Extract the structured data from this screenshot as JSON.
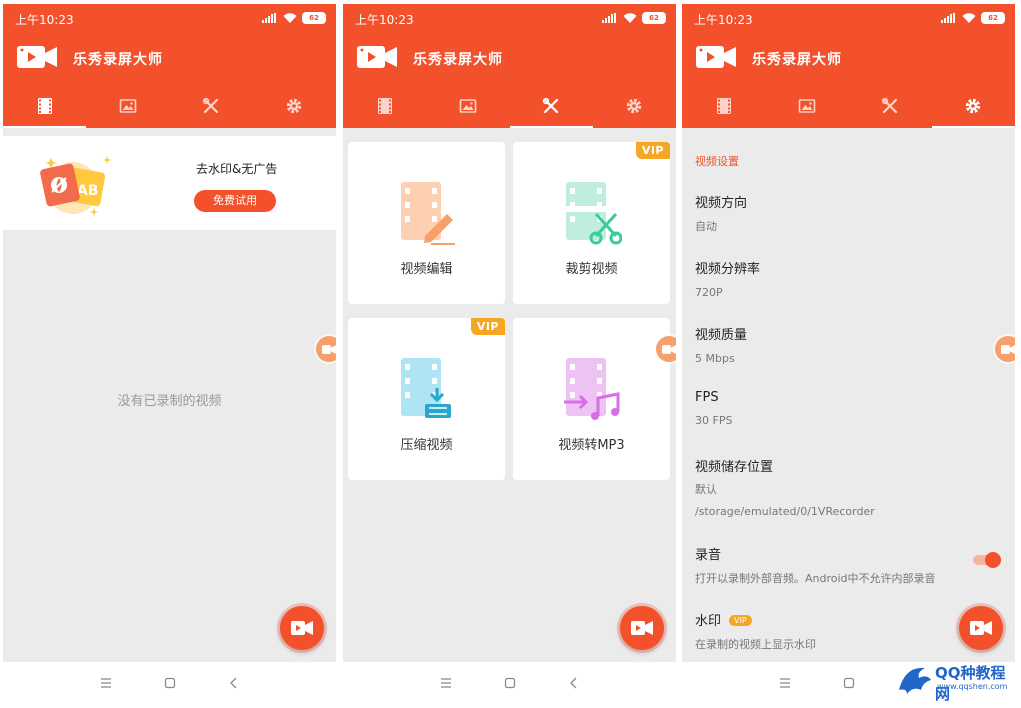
{
  "status": {
    "time": "上午10:23",
    "battery": "62"
  },
  "app": {
    "title": "乐秀录屏大师"
  },
  "tabs": [
    {
      "icon": "film-icon"
    },
    {
      "icon": "image-icon"
    },
    {
      "icon": "tools-icon"
    },
    {
      "icon": "gear-icon"
    }
  ],
  "screen1": {
    "promo": {
      "title": "去水印&无广告",
      "button": "免费试用",
      "art_text": "AB"
    },
    "empty_text": "没有已录制的视频"
  },
  "screen2": {
    "tools": [
      {
        "label": "视频编辑",
        "vip": false
      },
      {
        "label": "裁剪视频",
        "vip": true
      },
      {
        "label": "压缩视频",
        "vip": true
      },
      {
        "label": "视频转MP3",
        "vip": false
      }
    ],
    "vip_label": "VIP"
  },
  "screen3": {
    "section_title": "视频设置",
    "settings": [
      {
        "name": "视频方向",
        "value": "自动"
      },
      {
        "name": "视频分辨率",
        "value": "720P"
      },
      {
        "name": "视频质量",
        "value": "5 Mbps"
      },
      {
        "name": "FPS",
        "value": "30 FPS"
      },
      {
        "name": "视频储存位置",
        "value_line1": "默认",
        "value_line2": "/storage/emulated/0/1VRecorder"
      },
      {
        "name": "录音",
        "value": "打开以录制外部音频。Android中不允许内部录音",
        "toggle_on": true
      },
      {
        "name": "水印",
        "badge": "VIP",
        "value": "在录制的视频上显示水印"
      }
    ]
  },
  "watermark": {
    "title": "QQ种教程网",
    "url": "www.qqshen.com"
  },
  "colors": {
    "primary": "#f2512c",
    "vip": "#f5a623",
    "background": "#ebebeb"
  }
}
